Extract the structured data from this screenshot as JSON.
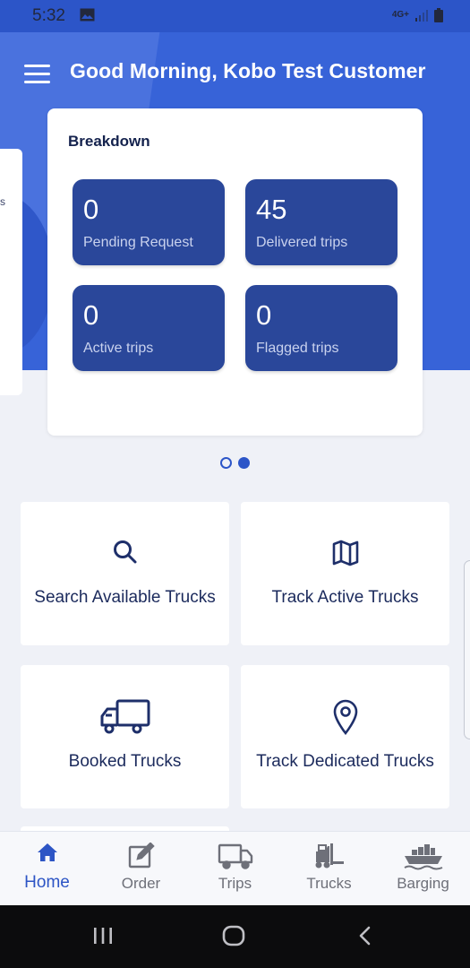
{
  "status_bar": {
    "time": "5:32",
    "icons": [
      "image-icon",
      "4g-data-icon",
      "signal-icon",
      "battery-icon"
    ],
    "network_label": "4G+"
  },
  "header": {
    "greeting": "Good Morning, Kobo Test Customer",
    "menu_icon": "hamburger-menu-icon"
  },
  "peek_card": {
    "text": "s"
  },
  "breakdown": {
    "title": "Breakdown",
    "stats": [
      {
        "value": "0",
        "label": "Pending Request"
      },
      {
        "value": "45",
        "label": "Delivered trips"
      },
      {
        "value": "0",
        "label": "Active trips"
      },
      {
        "value": "0",
        "label": "Flagged trips"
      }
    ]
  },
  "carousel": {
    "page_count": 2,
    "active_index": 1
  },
  "tiles": [
    {
      "label": "Search Available Trucks",
      "icon": "search-icon"
    },
    {
      "label": "Track Active Trucks",
      "icon": "map-icon"
    },
    {
      "label": "Booked Trucks",
      "icon": "truck-icon"
    },
    {
      "label": "Track Dedicated Trucks",
      "icon": "location-pin-icon"
    }
  ],
  "bottom_nav": {
    "items": [
      {
        "label": "Home",
        "icon": "home-icon",
        "active": true
      },
      {
        "label": "Order",
        "icon": "edit-icon",
        "active": false
      },
      {
        "label": "Trips",
        "icon": "truck-icon",
        "active": false
      },
      {
        "label": "Trucks",
        "icon": "forklift-icon",
        "active": false
      },
      {
        "label": "Barging",
        "icon": "ship-icon",
        "active": false
      }
    ]
  },
  "colors": {
    "brand_blue": "#3763d8",
    "stat_card": "#2a479a",
    "nav_active": "#2d55c5",
    "nav_inactive": "#6e7079"
  }
}
